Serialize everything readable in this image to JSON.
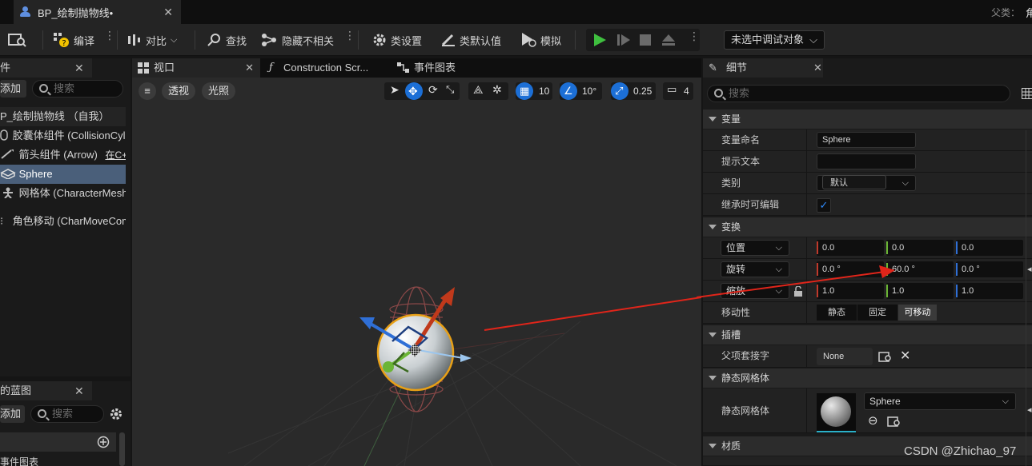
{
  "titlebar": {
    "doc_title": "BP_绘制抛物线•",
    "parent_label": "父类：",
    "parent_value": "角"
  },
  "toolbar": {
    "compile": "编译",
    "diff": "对比",
    "find": "查找",
    "hide_unrelated": "隐藏不相关",
    "class_settings": "类设置",
    "class_defaults": "类默认值",
    "simulate": "模拟",
    "debug_target": "未选中调试对象"
  },
  "components_panel": {
    "title": "件",
    "add": "添加",
    "search_placeholder": "搜索",
    "items": [
      {
        "label": "P_绘制抛物线 （自我）"
      },
      {
        "label": "胶囊体组件 (CollisionCylin"
      },
      {
        "label": "箭头组件 (Arrow)",
        "suffix": "在C+"
      },
      {
        "label": "Sphere"
      },
      {
        "label": "网格体 (CharacterMesh"
      },
      {
        "label": "角色移动 (CharMoveCom"
      }
    ]
  },
  "my_blueprint_panel": {
    "title": "的蓝图",
    "add": "添加",
    "search_placeholder": "搜索",
    "row_label": "事件图表"
  },
  "editor_tabs": {
    "viewport": "视口",
    "construction_script": "Construction Scr...",
    "event_graph": "事件图表"
  },
  "viewport_toolbar": {
    "perspective": "透视",
    "lit": "光照",
    "grid_snap": "10",
    "rotation_snap": "10°",
    "scale_snap": "0.25",
    "camera_speed": "4"
  },
  "details": {
    "title": "细节",
    "search_placeholder": "搜索",
    "categories": {
      "variable": "变量",
      "transform": "变换",
      "sockets": "插槽",
      "static_mesh": "静态网格体",
      "materials": "材质"
    },
    "variable": {
      "name_label": "变量命名",
      "name_value": "Sphere",
      "tooltip_label": "提示文本",
      "tooltip_value": "",
      "category_label": "类别",
      "category_value": "默认",
      "editable_label": "继承时可编辑",
      "editable_checked": true
    },
    "transform": {
      "location_label": "位置",
      "location": [
        "0.0",
        "0.0",
        "0.0"
      ],
      "rotation_label": "旋转",
      "rotation": [
        "0.0 °",
        "60.0 °",
        "0.0 °"
      ],
      "scale_label": "缩放",
      "scale": [
        "1.0",
        "1.0",
        "1.0"
      ],
      "mobility_label": "移动性",
      "mobility_options": [
        "静态",
        "固定",
        "可移动"
      ],
      "mobility_selected": "可移动"
    },
    "sockets": {
      "parent_socket_label": "父项套接字",
      "parent_socket_value": "None"
    },
    "static_mesh": {
      "label": "静态网格体",
      "value": "Sphere"
    }
  },
  "colors": {
    "accent_blue": "#1c6fd6",
    "selection": "#4a5f7a",
    "play_green": "#3fbf3f",
    "x_axis": "#c0392b",
    "y_axis": "#6bb536",
    "z_axis": "#2f6fd6"
  },
  "watermark": "CSDN @Zhichao_97"
}
